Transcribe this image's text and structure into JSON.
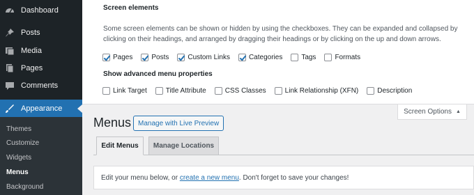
{
  "sidebar": {
    "items": [
      {
        "label": "Dashboard",
        "icon": "dashboard-icon"
      },
      {
        "label": "Posts",
        "icon": "pin-icon"
      },
      {
        "label": "Media",
        "icon": "media-icon"
      },
      {
        "label": "Pages",
        "icon": "pages-icon"
      },
      {
        "label": "Comments",
        "icon": "comment-icon"
      },
      {
        "label": "Appearance",
        "icon": "brush-icon"
      }
    ],
    "submenu": [
      "Themes",
      "Customize",
      "Widgets",
      "Menus",
      "Background"
    ],
    "active_color": "#2271b1"
  },
  "screen_options": {
    "heading": "Screen elements",
    "description": "Some screen elements can be shown or hidden by using the checkboxes. They can be expanded and collapsed by clicking on their headings, and arranged by dragging their headings or by clicking on the up and down arrows.",
    "elements": [
      {
        "label": "Pages",
        "checked": true
      },
      {
        "label": "Posts",
        "checked": true
      },
      {
        "label": "Custom Links",
        "checked": true
      },
      {
        "label": "Categories",
        "checked": true
      },
      {
        "label": "Tags",
        "checked": false
      },
      {
        "label": "Formats",
        "checked": false
      }
    ],
    "advanced_heading": "Show advanced menu properties",
    "advanced": [
      {
        "label": "Link Target",
        "checked": false
      },
      {
        "label": "Title Attribute",
        "checked": false
      },
      {
        "label": "CSS Classes",
        "checked": false
      },
      {
        "label": "Link Relationship (XFN)",
        "checked": false
      },
      {
        "label": "Description",
        "checked": false
      }
    ],
    "tab_label": "Screen Options",
    "tab_arrow": "▲"
  },
  "main": {
    "title": "Menus",
    "live_preview_label": "Manage with Live Preview",
    "tabs": [
      {
        "label": "Edit Menus",
        "active": true
      },
      {
        "label": "Manage Locations",
        "active": false
      }
    ],
    "notice": {
      "before": "Edit your menu below, or ",
      "link": "create a new menu",
      "after": ". Don't forget to save your changes!"
    }
  }
}
